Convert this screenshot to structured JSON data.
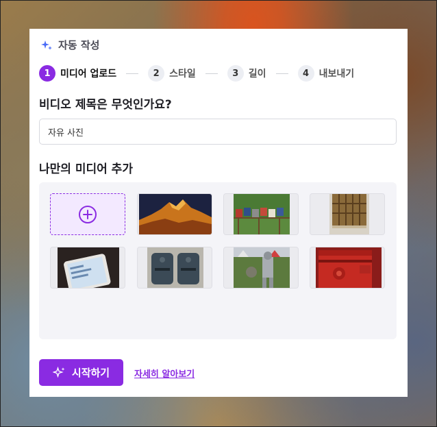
{
  "header": {
    "title": "자동 작성",
    "icon": "sparkle-icon",
    "icon_color": "#4a6cf7"
  },
  "steps": [
    {
      "num": "1",
      "label": "미디어 업로드",
      "active": true
    },
    {
      "num": "2",
      "label": "스타일",
      "active": false
    },
    {
      "num": "3",
      "label": "길이",
      "active": false
    },
    {
      "num": "4",
      "label": "내보내기",
      "active": false
    }
  ],
  "question": {
    "title": "비디오 제목은 무엇인가요?",
    "input_value": "자유 사진"
  },
  "media": {
    "title": "나만의 미디어 추가",
    "add_icon": "plus-circle-icon",
    "thumbnails": [
      {
        "name": "mountain-sunset"
      },
      {
        "name": "mailboxes-row"
      },
      {
        "name": "wooden-window"
      },
      {
        "name": "smartphone"
      },
      {
        "name": "wall-mailboxes"
      },
      {
        "name": "knight-armor"
      },
      {
        "name": "red-postbox"
      }
    ]
  },
  "actions": {
    "start_label": "시작하기",
    "learn_more_label": "자세히 알아보기"
  },
  "colors": {
    "accent": "#8a2be2",
    "active_step": "#8a2be2"
  }
}
